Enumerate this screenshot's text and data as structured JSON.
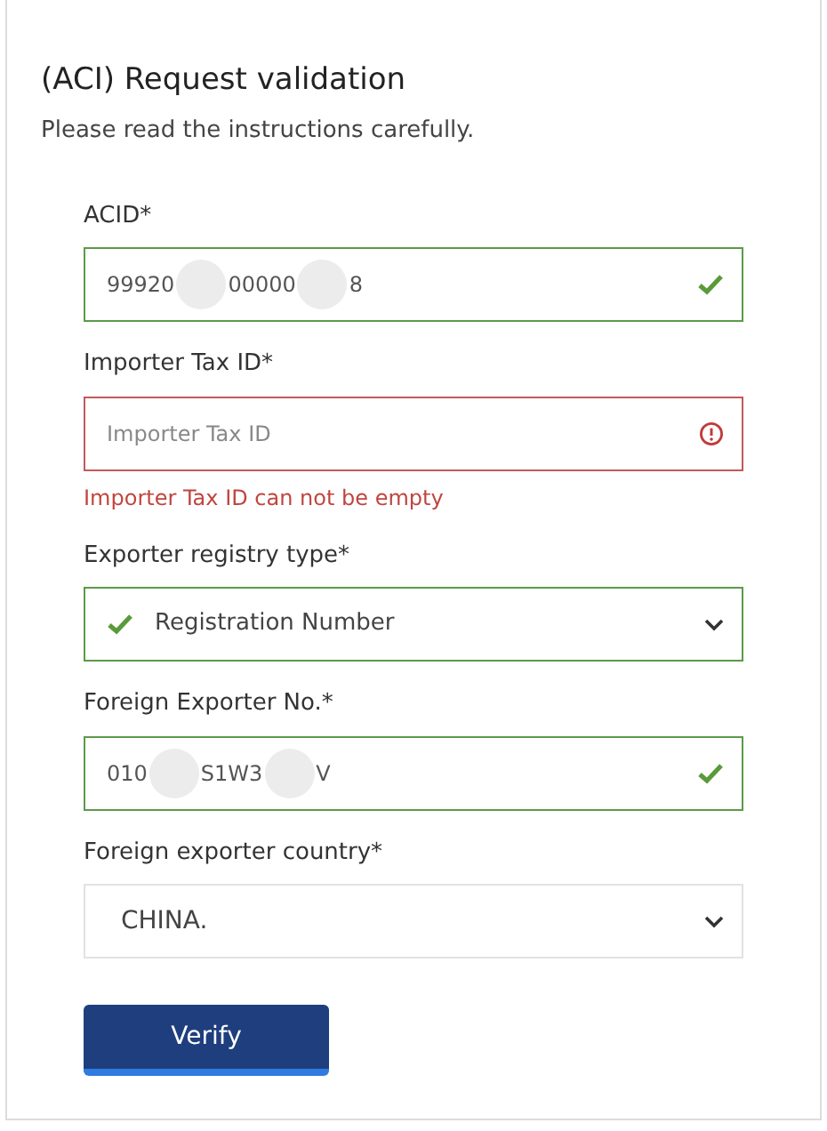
{
  "title": "(ACI) Request validation",
  "subtitle": "Please read the instructions carefully.",
  "fields": [
    {
      "kind": "input",
      "label": "ACID*",
      "value_parts": [
        "99920",
        "00000",
        "8"
      ],
      "valid": true,
      "invalid": false
    },
    {
      "kind": "input",
      "label": "Importer Tax ID*",
      "placeholder": "Importer Tax ID",
      "valid": false,
      "invalid": true,
      "error": "Importer Tax ID can not be empty"
    },
    {
      "kind": "select",
      "label": "Exporter registry type*",
      "value": "Registration Number",
      "valid": true,
      "invalid": false
    },
    {
      "kind": "input",
      "label": "Foreign Exporter No.*",
      "value_parts": [
        "010",
        "S1W3",
        "V"
      ],
      "valid": true,
      "invalid": false
    },
    {
      "kind": "select",
      "label": "Foreign exporter country*",
      "value": "CHINA.",
      "valid": false,
      "invalid": false
    }
  ],
  "button": "Verify"
}
